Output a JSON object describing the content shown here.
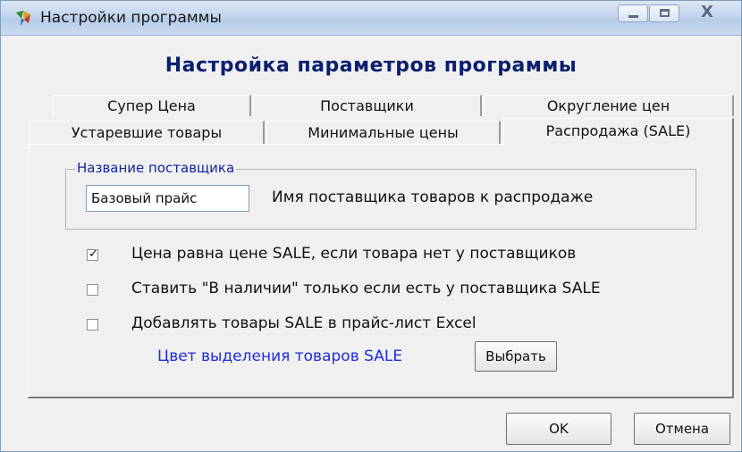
{
  "window": {
    "title": "Настройки программы",
    "icon": "app-icon"
  },
  "dialog": {
    "heading": "Настройка параметров программы"
  },
  "tabs": {
    "row_back": [
      {
        "label": "Супер Цена"
      },
      {
        "label": "Поставщики"
      },
      {
        "label": "Округление цен"
      }
    ],
    "row_front": [
      {
        "label": "Устаревшие товары"
      },
      {
        "label": "Минимальные цены"
      },
      {
        "label": "Распродажа (SALE)",
        "active": true
      }
    ]
  },
  "supplier_group": {
    "legend": "Название поставщика",
    "input_value": "Базовый прайс",
    "description": "Имя поставщика товаров к распродаже"
  },
  "options": [
    {
      "label": "Цена равна цене SALE, если товара нет у поставщиков",
      "checked": true
    },
    {
      "label": "Ставить \"В наличии\" только если есть у поставщика SALE",
      "checked": false
    },
    {
      "label": "Добавлять товары SALE в прайс-лист Excel",
      "checked": false
    }
  ],
  "highlight": {
    "label": "Цвет выделения товаров SALE",
    "label_color": "#1f2be0",
    "button": "Выбрать"
  },
  "footer": {
    "ok": "OK",
    "cancel": "Отмена"
  }
}
